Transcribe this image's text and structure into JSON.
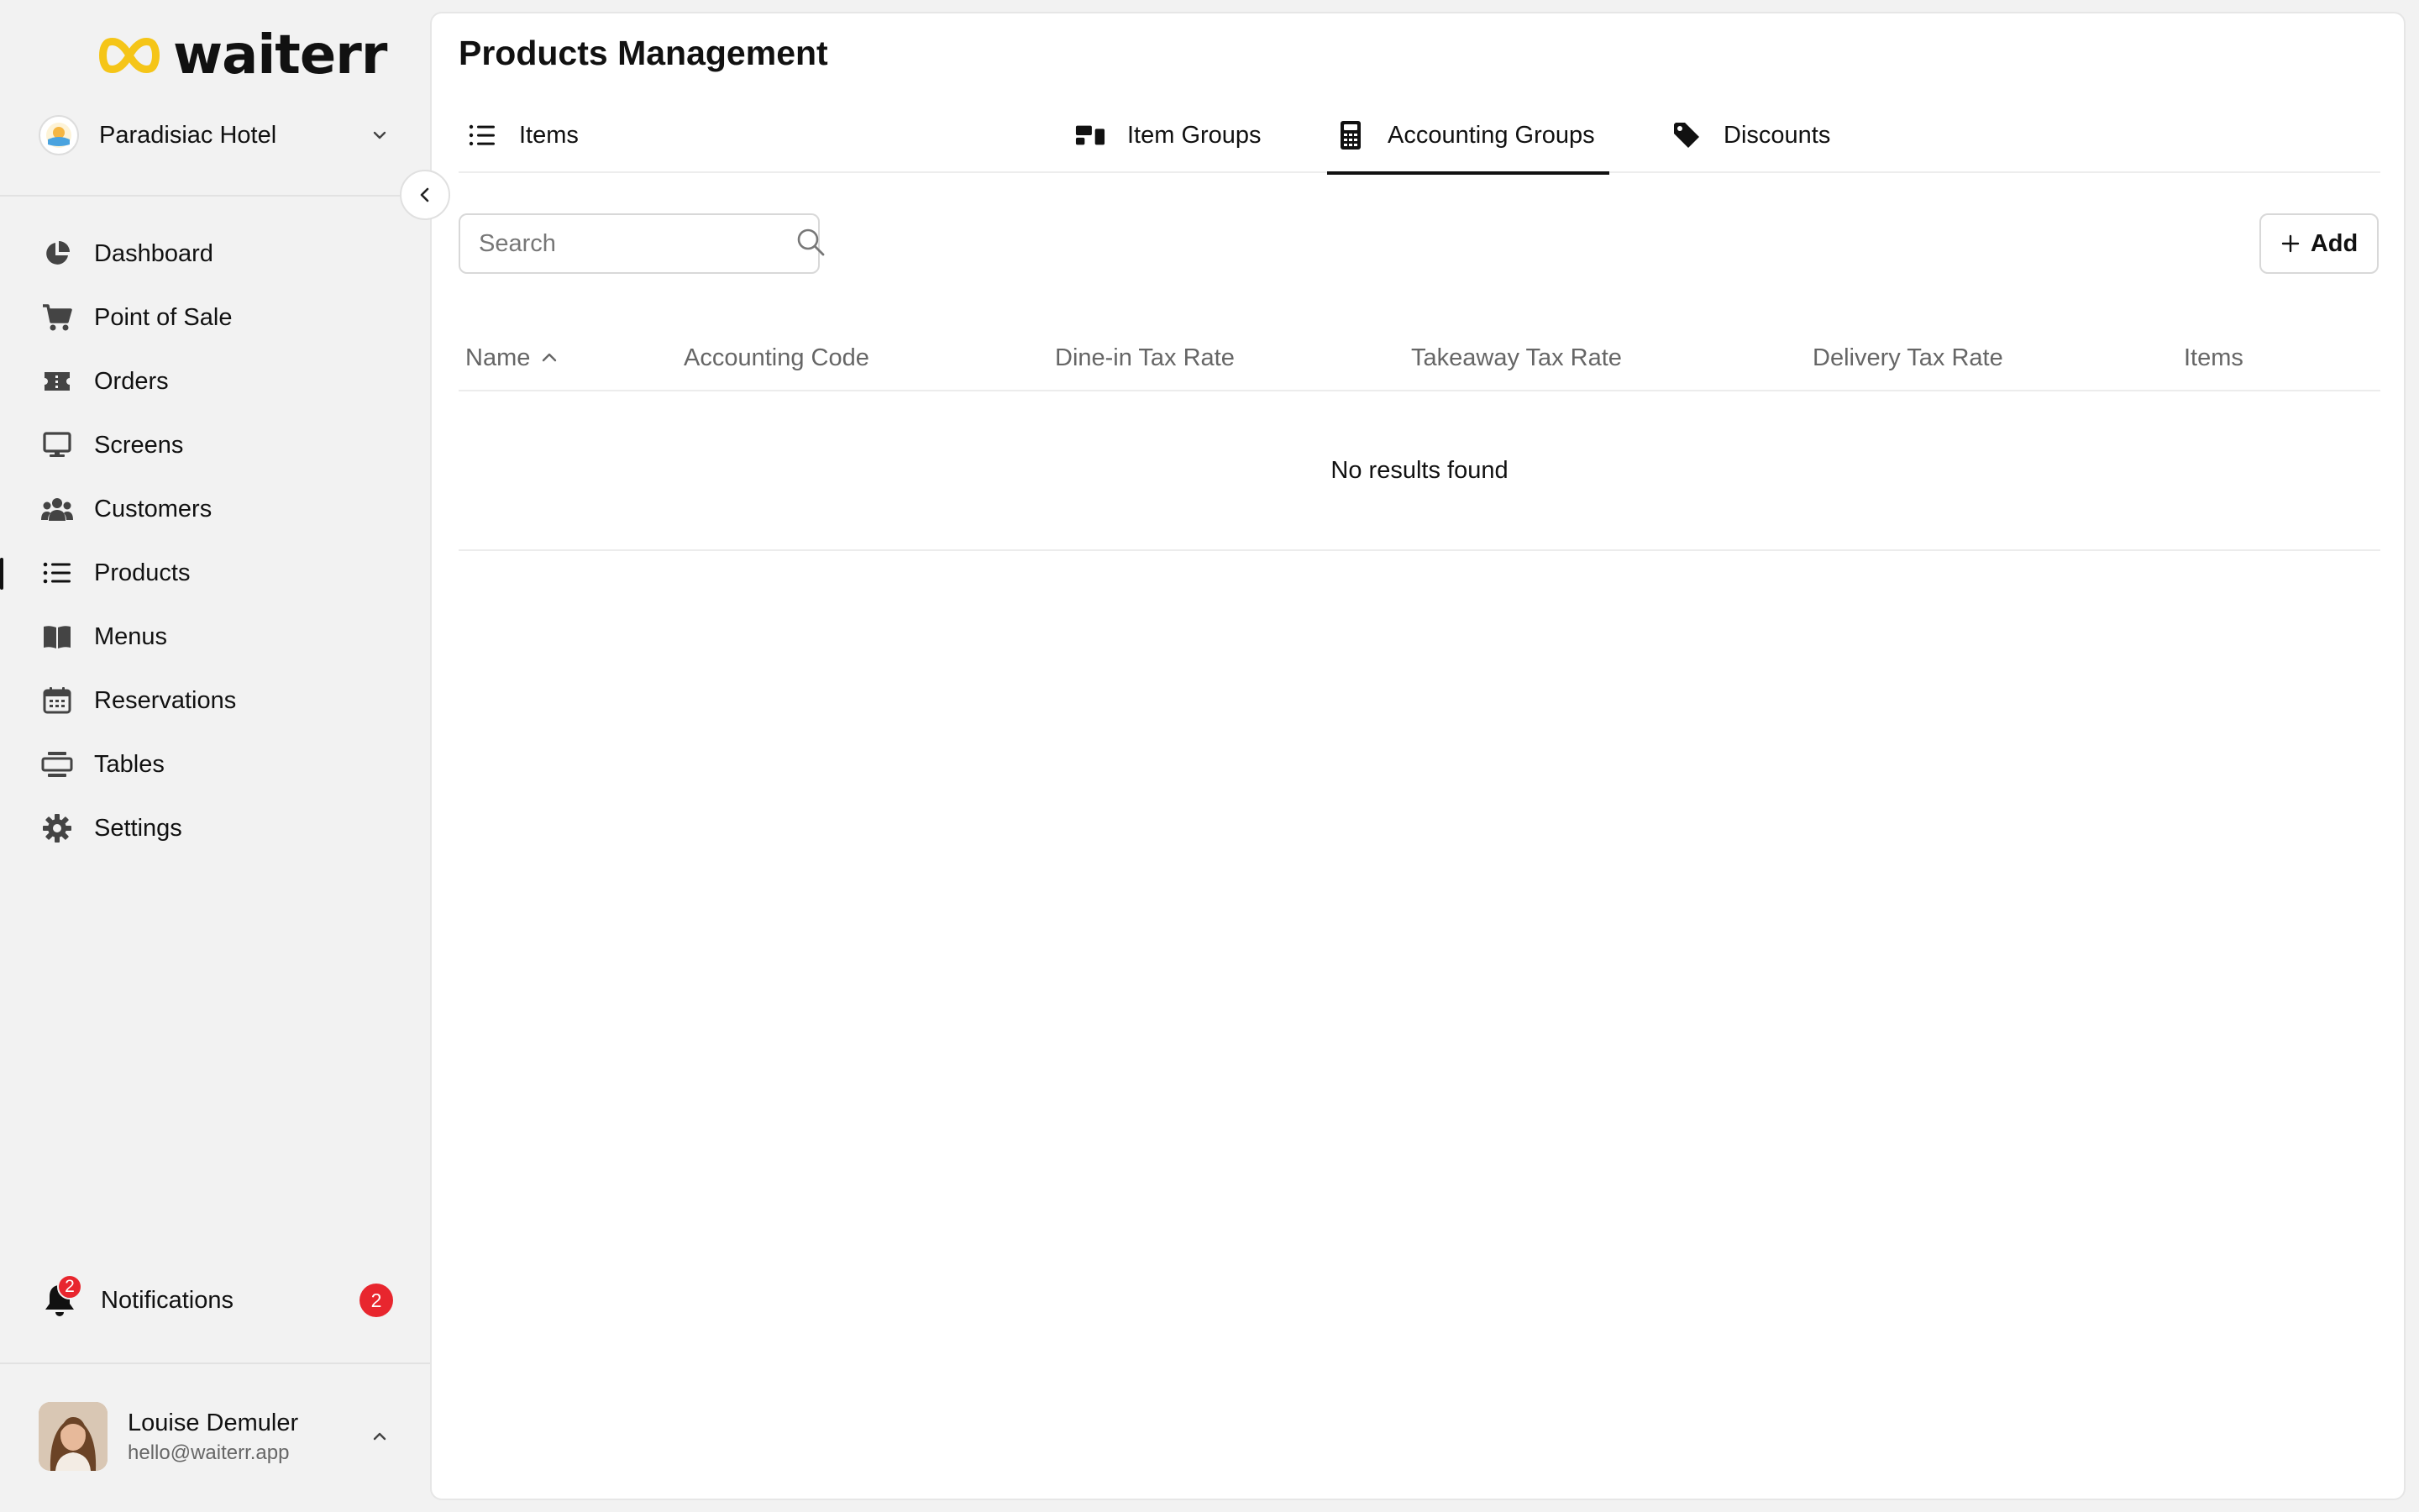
{
  "app": {
    "logo_text": "waiterr",
    "logo_color": "#f5c518"
  },
  "venue": {
    "name": "Paradisiac Hotel"
  },
  "sidebar": {
    "items": [
      {
        "label": "Dashboard",
        "icon": "pie-chart-icon"
      },
      {
        "label": "Point of Sale",
        "icon": "cart-icon"
      },
      {
        "label": "Orders",
        "icon": "ticket-icon"
      },
      {
        "label": "Screens",
        "icon": "monitor-icon"
      },
      {
        "label": "Customers",
        "icon": "users-icon"
      },
      {
        "label": "Products",
        "icon": "list-icon",
        "active": true
      },
      {
        "label": "Menus",
        "icon": "book-icon"
      },
      {
        "label": "Reservations",
        "icon": "calendar-icon"
      },
      {
        "label": "Tables",
        "icon": "table-icon"
      },
      {
        "label": "Settings",
        "icon": "gear-icon"
      }
    ],
    "notifications": {
      "label": "Notifications",
      "count": "2",
      "bell_badge": "2"
    }
  },
  "user": {
    "name": "Louise Demuler",
    "email": "hello@waiterr.app"
  },
  "main": {
    "title": "Products Management",
    "tabs": [
      {
        "label": "Items",
        "icon": "list-icon"
      },
      {
        "label": "Item Groups",
        "icon": "item-groups-icon"
      },
      {
        "label": "Accounting Groups",
        "icon": "calculator-icon",
        "active": true
      },
      {
        "label": "Discounts",
        "icon": "tag-icon"
      }
    ],
    "search": {
      "placeholder": "Search",
      "value": ""
    },
    "add_label": "Add",
    "table": {
      "columns": [
        "Name",
        "Accounting Code",
        "Dine-in Tax Rate",
        "Takeaway Tax Rate",
        "Delivery Tax Rate",
        "Items"
      ],
      "sort_column": "Name",
      "sort_direction": "ascending",
      "rows": [],
      "empty_text": "No results found"
    }
  },
  "colors": {
    "badge": "#e8262e",
    "sidebar_bg": "#f2f2f2",
    "accent": "#111111"
  }
}
